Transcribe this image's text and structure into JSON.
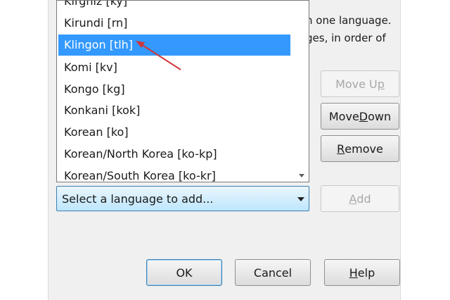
{
  "description": {
    "line1": "n one language.",
    "line2": "ges, in order of"
  },
  "language_list": {
    "items": [
      "Kirghiz  [ky]",
      "Kirundi  [rn]",
      "Klingon  [tlh]",
      "Komi  [kv]",
      "Kongo  [kg]",
      "Konkani  [kok]",
      "Korean  [ko]",
      "Korean/North Korea  [ko-kp]",
      "Korean/South Korea  [ko-kr]"
    ],
    "selected": "Klingon  [tlh]"
  },
  "add_language_select": {
    "value": "Select a language to add..."
  },
  "buttons": {
    "move_up": {
      "pre": "Move U",
      "key": "p",
      "post": ""
    },
    "move_down": {
      "pre": "Move ",
      "key": "D",
      "post": "own"
    },
    "remove": {
      "pre": "",
      "key": "R",
      "post": "emove"
    },
    "add": {
      "pre": "",
      "key": "A",
      "post": "dd"
    },
    "ok": "OK",
    "cancel": "Cancel",
    "help": {
      "pre": "",
      "key": "H",
      "post": "elp"
    }
  },
  "colors": {
    "selection": "#3399ff",
    "annotation_arrow": "#d0343a"
  }
}
